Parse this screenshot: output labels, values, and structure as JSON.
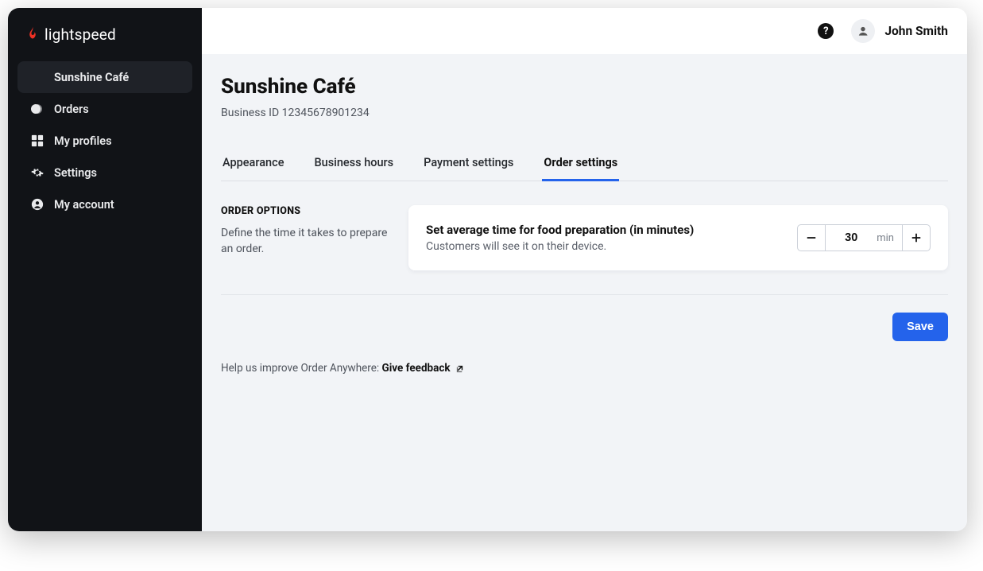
{
  "brand": {
    "name": "lightspeed"
  },
  "sidebar": {
    "items": [
      {
        "label": "Sunshine Café"
      },
      {
        "label": "Orders"
      },
      {
        "label": "My profiles"
      },
      {
        "label": "Settings"
      },
      {
        "label": "My account"
      }
    ]
  },
  "topbar": {
    "user_name": "John Smith"
  },
  "page": {
    "title": "Sunshine Café",
    "business_id_label": "Business ID 12345678901234"
  },
  "tabs": {
    "appearance": "Appearance",
    "business_hours": "Business hours",
    "payment_settings": "Payment settings",
    "order_settings": "Order settings"
  },
  "order_options": {
    "caption": "ORDER OPTIONS",
    "description": "Define the time it takes to prepare an order.",
    "card_title": "Set average time for food preparation (in minutes)",
    "card_sub": "Customers will see it on their device.",
    "value": "30",
    "unit": "min"
  },
  "actions": {
    "save": "Save"
  },
  "feedback": {
    "prefix": "Help us improve Order Anywhere: ",
    "link_label": "Give feedback"
  }
}
